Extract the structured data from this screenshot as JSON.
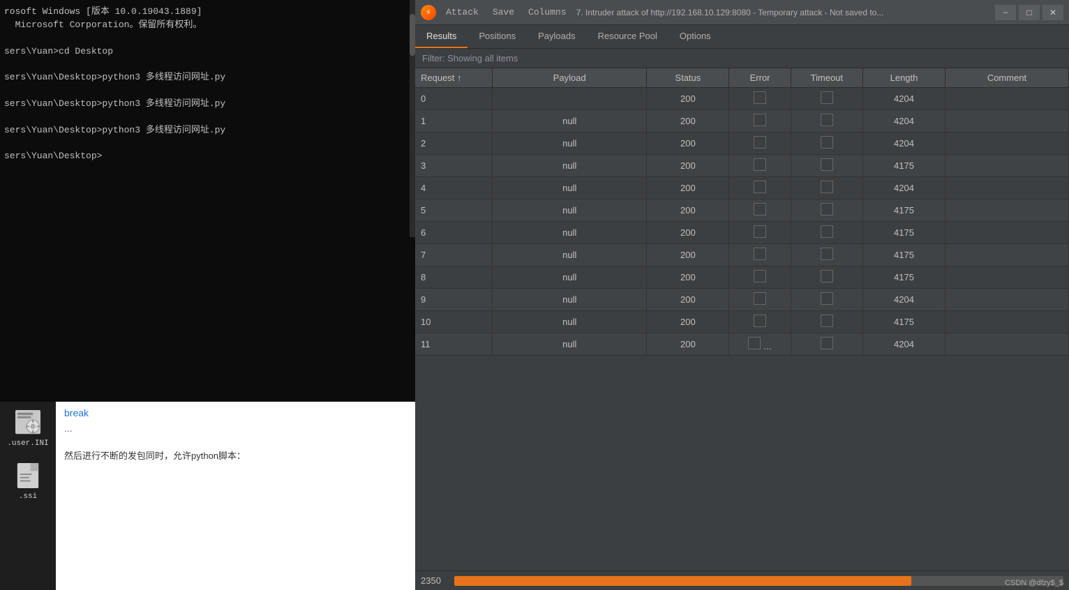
{
  "terminal": {
    "lines": [
      "rosoft Windows [版本 10.0.19043.1889]",
      "  Microsoft Corporation。保留所有权利。",
      "",
      "sers\\Yuan>cd Desktop",
      "",
      "sers\\Yuan\\Desktop>python3 多线程访问网址.py",
      "",
      "sers\\Yuan\\Desktop>python3 多线程访问网址.py",
      "",
      "sers\\Yuan\\Desktop>python3 多线程访问网址.py",
      "",
      "sers\\Yuan\\Desktop>"
    ]
  },
  "desktop_icons": [
    {
      "label": ".user.INI",
      "type": "gear"
    },
    {
      "label": ".ssi",
      "type": "file"
    }
  ],
  "blog": {
    "title": "break",
    "dots": "...",
    "text": "然后进行不断的发包同时，允许python脚本："
  },
  "burp": {
    "logo_char": "⚡",
    "menu": {
      "attack": "Attack",
      "save": "Save",
      "columns": "Columns"
    },
    "title": "7. Intruder attack of http://192.168.10.129:8080 - Temporary attack - Not saved to...",
    "tabs": [
      {
        "id": "results",
        "label": "Results",
        "active": true
      },
      {
        "id": "positions",
        "label": "Positions",
        "active": false
      },
      {
        "id": "payloads",
        "label": "Payloads",
        "active": false
      },
      {
        "id": "resource-pool",
        "label": "Resource Pool",
        "active": false
      },
      {
        "id": "options",
        "label": "Options",
        "active": false
      }
    ],
    "filter_text": "Filter: Showing all items",
    "table": {
      "headers": [
        {
          "id": "request",
          "label": "Request ↑"
        },
        {
          "id": "payload",
          "label": "Payload"
        },
        {
          "id": "status",
          "label": "Status"
        },
        {
          "id": "error",
          "label": "Error"
        },
        {
          "id": "timeout",
          "label": "Timeout"
        },
        {
          "id": "length",
          "label": "Length"
        },
        {
          "id": "comment",
          "label": "Comment"
        }
      ],
      "rows": [
        {
          "request": "0",
          "payload": "",
          "status": "200",
          "error": false,
          "timeout": false,
          "length": "4204",
          "comment": ""
        },
        {
          "request": "1",
          "payload": "null",
          "status": "200",
          "error": false,
          "timeout": false,
          "length": "4204",
          "comment": ""
        },
        {
          "request": "2",
          "payload": "null",
          "status": "200",
          "error": false,
          "timeout": false,
          "length": "4204",
          "comment": ""
        },
        {
          "request": "3",
          "payload": "null",
          "status": "200",
          "error": false,
          "timeout": false,
          "length": "4175",
          "comment": ""
        },
        {
          "request": "4",
          "payload": "null",
          "status": "200",
          "error": false,
          "timeout": false,
          "length": "4204",
          "comment": ""
        },
        {
          "request": "5",
          "payload": "null",
          "status": "200",
          "error": false,
          "timeout": false,
          "length": "4175",
          "comment": ""
        },
        {
          "request": "6",
          "payload": "null",
          "status": "200",
          "error": false,
          "timeout": false,
          "length": "4175",
          "comment": ""
        },
        {
          "request": "7",
          "payload": "null",
          "status": "200",
          "error": false,
          "timeout": false,
          "length": "4175",
          "comment": ""
        },
        {
          "request": "8",
          "payload": "null",
          "status": "200",
          "error": false,
          "timeout": false,
          "length": "4175",
          "comment": ""
        },
        {
          "request": "9",
          "payload": "null",
          "status": "200",
          "error": false,
          "timeout": false,
          "length": "4204",
          "comment": ""
        },
        {
          "request": "10",
          "payload": "null",
          "status": "200",
          "error": false,
          "timeout": false,
          "length": "4175",
          "comment": ""
        },
        {
          "request": "11",
          "payload": "null",
          "status": "200",
          "error": false,
          "timeout": false,
          "length": "4204",
          "comment": ""
        }
      ]
    },
    "statusbar": {
      "count": "2350",
      "progress_percent": 75
    },
    "csdn": "CSDN @dfzy$_$"
  }
}
